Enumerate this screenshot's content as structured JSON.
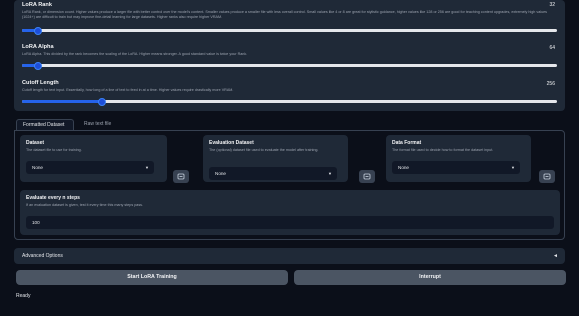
{
  "sliders": [
    {
      "title": "LoRA Rank",
      "description": "LoRA Rank, or dimension count. Higher values produce a larger file with better control over the model's content. Smaller values produce a smaller file with less overall control. Small values like 4 or 8 are great for stylistic guidance, higher values like 128 or 256 are good for teaching content upgrades, extremely high values (1024+) are difficult to train but may improve fine-detail learning for large datasets. Higher ranks also require higher VRAM.",
      "value": "32",
      "fraction": 0.03
    },
    {
      "title": "LoRA Alpha",
      "description": "LoRA Alpha. This divided by the rank becomes the scaling of the LoRA. Higher means stronger. A good standard value is twice your Rank.",
      "value": "64",
      "fraction": 0.03
    },
    {
      "title": "Cutoff Length",
      "description": "Cutoff length for text input. Essentially, how long of a line of text to feed in at a time. Higher values require drastically more VRAM.",
      "value": "256",
      "fraction": 0.15
    }
  ],
  "tabs": [
    "Formatted Dataset",
    "Raw text file"
  ],
  "dataset": {
    "title": "Dataset",
    "description": "The dataset file to use for training.",
    "selected": "None"
  },
  "eval_dataset": {
    "title": "Evaluation Dataset",
    "description": "The (optional) dataset file used to evaluate the model after training.",
    "selected": "None"
  },
  "data_format": {
    "title": "Data Format",
    "description": "The format file used to decide how to format the dataset input.",
    "selected": "None"
  },
  "eval_steps": {
    "title": "Evaluate every n steps",
    "description": "If an evaluation dataset is given, test it every time this many steps pass.",
    "value": "100"
  },
  "advanced": {
    "label": "Advanced Options",
    "arrow": "◄"
  },
  "buttons": {
    "start": "Start LoRA Training",
    "interrupt": "Interrupt"
  },
  "status": "Ready",
  "icons": {
    "caret": "▼",
    "refresh": "refresh-icon"
  },
  "colors": {
    "accent": "#2563eb",
    "background": "#0b0f19",
    "panel": "#1f2937"
  }
}
